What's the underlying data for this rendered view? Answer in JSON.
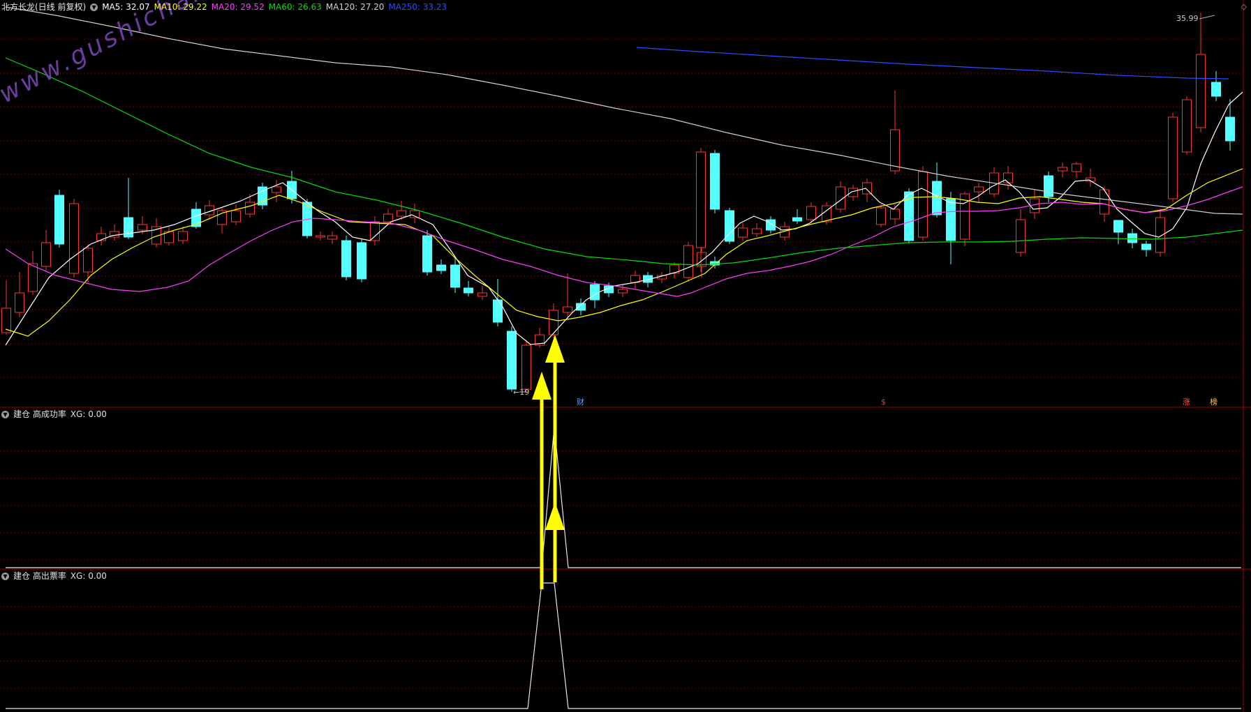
{
  "header": {
    "stock_title": "北方长龙(日线 前复权)",
    "ma_labels": [
      {
        "text": "MA5: 32.07",
        "color": "#ffffff"
      },
      {
        "text": "MA10: 29.22",
        "color": "#ffff00"
      },
      {
        "text": "MA20: 29.52",
        "color": "#ff3cff"
      },
      {
        "text": "MA60: 26.63",
        "color": "#00e000"
      },
      {
        "text": "MA120: 27.20",
        "color": "#d0d0d0"
      },
      {
        "text": "MA250: 33.23",
        "color": "#2a4cff"
      }
    ]
  },
  "price_markers": {
    "high_label": "35.99",
    "low_label": "←19"
  },
  "event_markers": {
    "cai": "财",
    "dollar": "$",
    "zhang": "涨",
    "bang": "榜"
  },
  "panels": [
    {
      "title": "建仓 高成功率",
      "xg": "XG: 0.00"
    },
    {
      "title": "建仓 高出票率",
      "xg": "XG: 0.00"
    }
  ],
  "watermark": "www.gushichanghong.com",
  "icons": {
    "collapse": "chevron-down-icon",
    "corner": "diamond-icon"
  },
  "colors": {
    "up": "#ff3232",
    "down": "#54ffff",
    "arrow": "#ffff00",
    "grid": "#7a0000",
    "divider": "#a00000"
  }
}
